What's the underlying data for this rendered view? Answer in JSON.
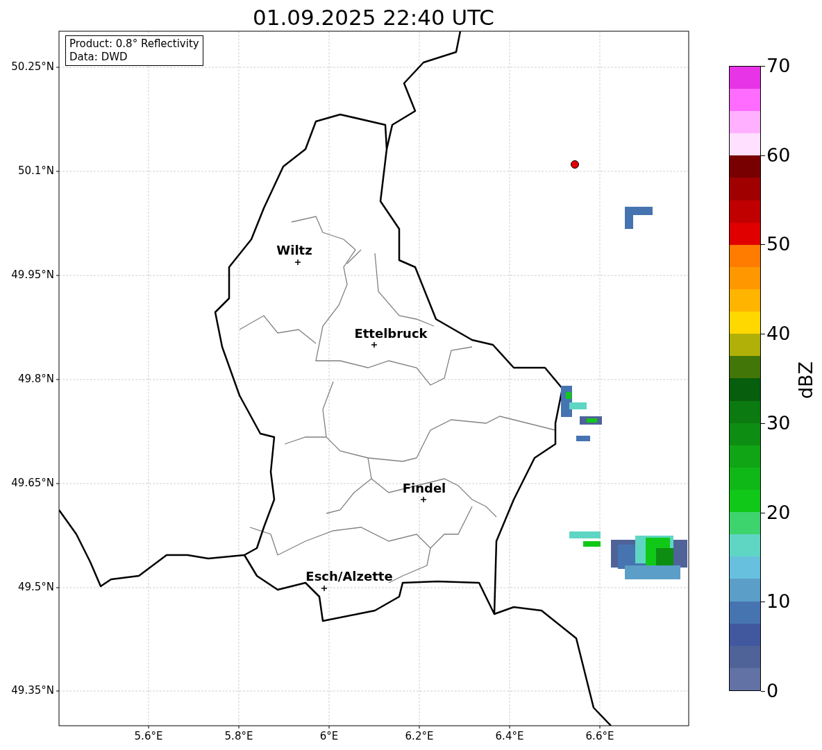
{
  "title": "01.09.2025 22:40 UTC",
  "info_box": [
    "Product: 0.8° Reflectivity",
    "Data: DWD"
  ],
  "y_axis": {
    "ticks": [
      "50.25°N",
      "50.1°N",
      "49.95°N",
      "49.8°N",
      "49.65°N",
      "49.5°N",
      "49.35°N"
    ]
  },
  "x_axis": {
    "ticks": [
      "5.6°E",
      "5.8°E",
      "6°E",
      "6.2°E",
      "6.4°E",
      "6.6°E"
    ]
  },
  "cities": [
    {
      "name": "Wiltz"
    },
    {
      "name": "Ettelbruck"
    },
    {
      "name": "Findel"
    },
    {
      "name": "Esch/Alzette"
    }
  ],
  "colorbar": {
    "label": "dBZ",
    "ticks": [
      "70",
      "60",
      "50",
      "40",
      "30",
      "20",
      "10",
      "0"
    ],
    "segments": [
      {
        "color": "#6272a4"
      },
      {
        "color": "#4f6399"
      },
      {
        "color": "#42589e"
      },
      {
        "color": "#4674b0"
      },
      {
        "color": "#5b9ec8"
      },
      {
        "color": "#66c0de"
      },
      {
        "color": "#5fd6c3"
      },
      {
        "color": "#3dd46e"
      },
      {
        "color": "#10c818"
      },
      {
        "color": "#10b817"
      },
      {
        "color": "#10a514"
      },
      {
        "color": "#0d8d12"
      },
      {
        "color": "#0b7a10"
      },
      {
        "color": "#075e0c"
      },
      {
        "color": "#437609"
      },
      {
        "color": "#b0b008"
      },
      {
        "color": "#ffd800"
      },
      {
        "color": "#ffb400"
      },
      {
        "color": "#ff9800"
      },
      {
        "color": "#ff7c00"
      },
      {
        "color": "#e00000"
      },
      {
        "color": "#c00000"
      },
      {
        "color": "#a00000"
      },
      {
        "color": "#780000"
      },
      {
        "color": "#ffe0ff"
      },
      {
        "color": "#ffb0ff"
      },
      {
        "color": "#ff6cff"
      },
      {
        "color": "#e634e6"
      }
    ]
  }
}
